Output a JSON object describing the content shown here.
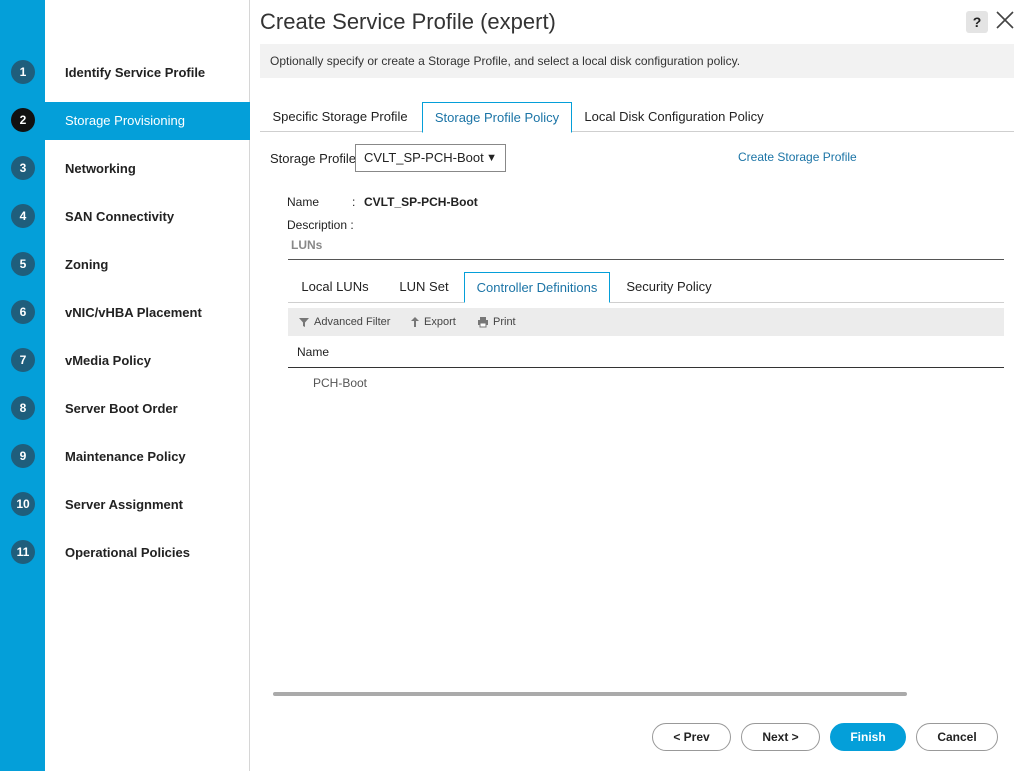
{
  "wizard": {
    "steps": [
      {
        "num": "1",
        "label": "Identify Service Profile"
      },
      {
        "num": "2",
        "label": "Storage Provisioning"
      },
      {
        "num": "3",
        "label": "Networking"
      },
      {
        "num": "4",
        "label": "SAN Connectivity"
      },
      {
        "num": "5",
        "label": "Zoning"
      },
      {
        "num": "6",
        "label": "vNIC/vHBA Placement"
      },
      {
        "num": "7",
        "label": "vMedia Policy"
      },
      {
        "num": "8",
        "label": "Server Boot Order"
      },
      {
        "num": "9",
        "label": "Maintenance Policy"
      },
      {
        "num": "10",
        "label": "Server Assignment"
      },
      {
        "num": "11",
        "label": "Operational Policies"
      }
    ],
    "active_step": "2"
  },
  "dialog": {
    "title": "Create Service Profile (expert)",
    "help": "?",
    "description": "Optionally specify or create a Storage Profile, and select a local disk configuration policy."
  },
  "tabs": [
    {
      "label": "Specific Storage Profile"
    },
    {
      "label": "Storage Profile Policy"
    },
    {
      "label": "Local Disk Configuration Policy"
    }
  ],
  "storage_profile": {
    "label": "Storage Profile:",
    "selected": "CVLT_SP-PCH-Boot",
    "create_link": "Create Storage Profile",
    "name_label": "Name",
    "name_colon": ":",
    "name_value": "CVLT_SP-PCH-Boot",
    "description_label": "Description :",
    "luns_label": "LUNs"
  },
  "subtabs": [
    {
      "label": "Local LUNs"
    },
    {
      "label": "LUN Set"
    },
    {
      "label": "Controller Definitions"
    },
    {
      "label": "Security Policy"
    }
  ],
  "toolbar": {
    "filter": "Advanced Filter",
    "export": "Export",
    "print": "Print"
  },
  "table": {
    "column": "Name",
    "rows": [
      "PCH-Boot"
    ]
  },
  "footer": {
    "prev": "< Prev",
    "next": "Next >",
    "finish": "Finish",
    "cancel": "Cancel"
  },
  "colors": {
    "accent": "#049fd9",
    "link": "#1b74a6",
    "step_circle": "#1f5e7c"
  }
}
